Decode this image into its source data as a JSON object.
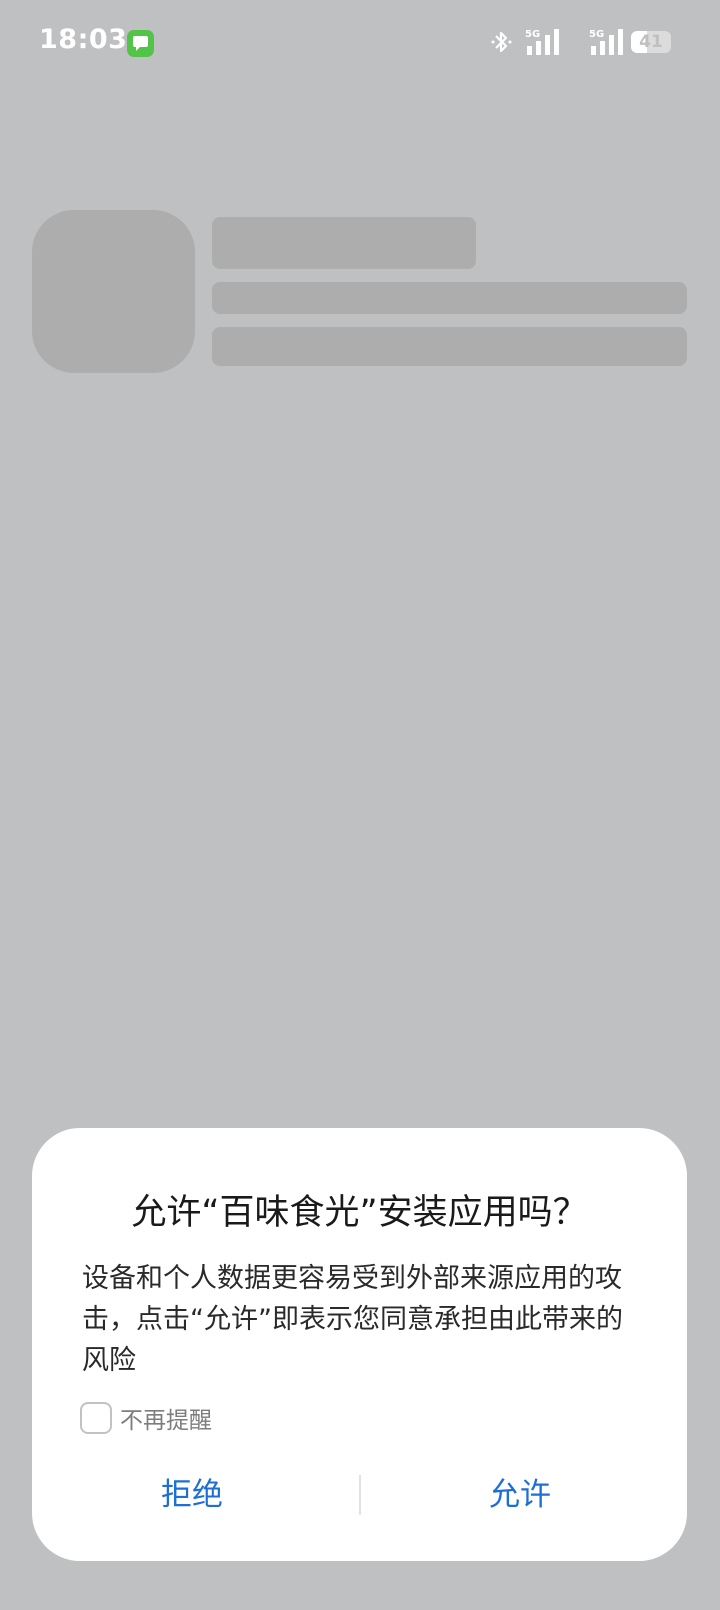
{
  "status_bar": {
    "time": "18:03",
    "network1": "5G",
    "network2": "5G",
    "battery_level": "41",
    "battery_fraction": 0.41,
    "icons": [
      "message-app-icon",
      "bluetooth-icon",
      "signal-icon",
      "signal-icon",
      "battery-icon"
    ]
  },
  "dialog": {
    "title": "允许“百味食光”安装应用吗？",
    "message": "设备和个人数据更容易受到外部来源应用的攻击，点击“允许”即表示您同意承担由此带来的风险",
    "checkbox_label": "不再提醒",
    "checkbox_checked": false,
    "deny_label": "拒绝",
    "allow_label": "允许",
    "accent_color": "#1d6fd6"
  }
}
